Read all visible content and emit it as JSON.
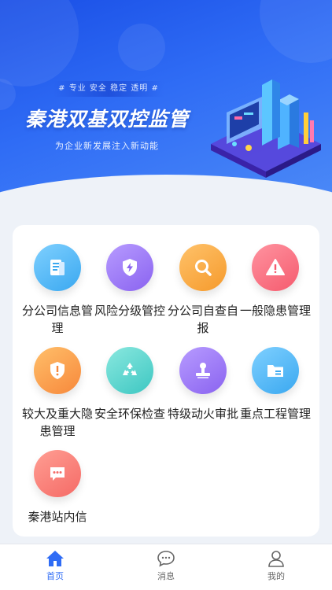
{
  "banner": {
    "tags": "#  专业 安全 稳定 透明  #",
    "title": "秦港双基双控监管",
    "subtitle": "为企业新发展注入新动能"
  },
  "grid": [
    {
      "label": "分公司信息管理",
      "icon": "document-icon",
      "color": "#3aa8f0"
    },
    {
      "label": "风险分级管控",
      "icon": "shield-lightning-icon",
      "color": "#8a63f0"
    },
    {
      "label": "分公司自查自报",
      "icon": "magnifier-icon",
      "color": "#f59a2c"
    },
    {
      "label": "一般隐患管理",
      "icon": "warning-icon",
      "color": "#f55b6e"
    },
    {
      "label": "较大及重大隐患管理",
      "icon": "shield-alert-icon",
      "color": "#f7883b"
    },
    {
      "label": "安全环保检查",
      "icon": "recycle-icon",
      "color": "#3dc7c2"
    },
    {
      "label": "特级动火审批",
      "icon": "stamp-icon",
      "color": "#8a63f0"
    },
    {
      "label": "重点工程管理",
      "icon": "folder-icon",
      "color": "#3aa8f0"
    },
    {
      "label": "秦港站内信",
      "icon": "message-icon",
      "color": "#f56a66"
    }
  ],
  "tabbar": {
    "items": [
      {
        "label": "首页",
        "icon": "home-icon",
        "active": true
      },
      {
        "label": "消息",
        "icon": "chat-icon",
        "active": false
      },
      {
        "label": "我的",
        "icon": "user-icon",
        "active": false
      }
    ],
    "active_color": "#2f6cf5",
    "inactive_color": "#666666"
  }
}
